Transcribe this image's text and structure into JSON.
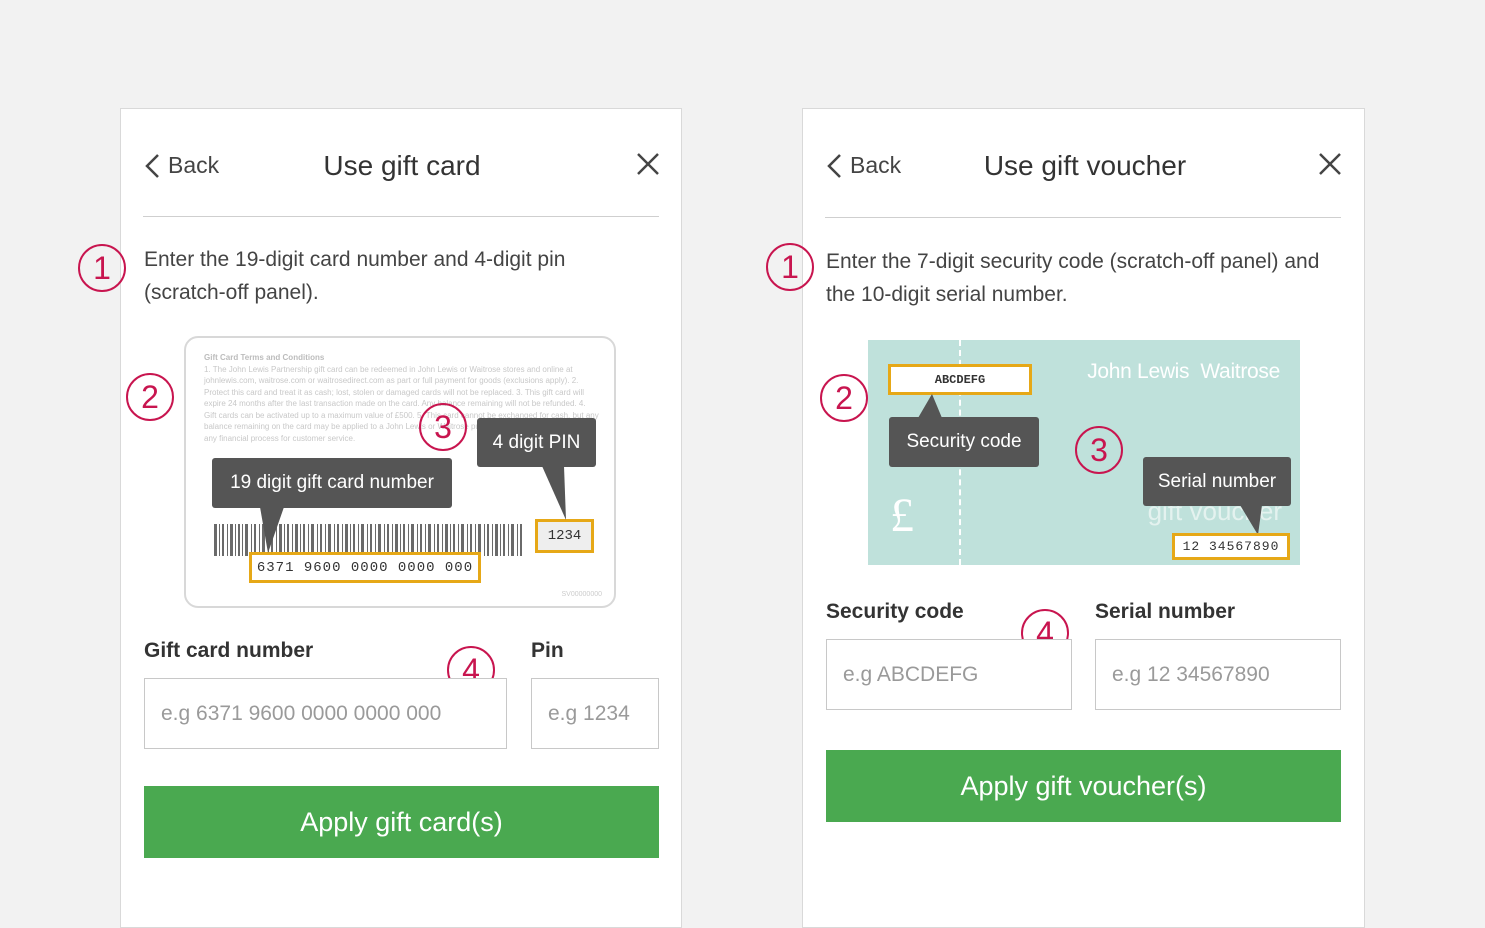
{
  "gift_card_panel": {
    "back_label": "Back",
    "title": "Use gift card",
    "instruction": "Enter the 19-digit card number and 4-digit pin (scratch-off panel).",
    "steps": [
      "1",
      "2",
      "3",
      "4"
    ],
    "card_image": {
      "terms_heading": "Gift Card Terms and Conditions",
      "terms_text": "1. The John Lewis Partnership gift card can be redeemed in John Lewis or Waitrose stores and online at johnlewis.com, waitrose.com or waitrosedirect.com as part or full payment for goods (exclusions apply). 2. Protect this card and treat it as cash; lost, stolen or damaged cards will not be replaced. 3. This gift card will expire 24 months after the last transaction made on the card. Any balance remaining will not be refunded. 4. Gift cards can be activated up to a maximum value of £500. 5. This card cannot be exchanged for cash, but any balance remaining on the card may be applied to a John Lewis or Waitrose purchase at any of our stores or by any financial process for customer service.",
      "card_number_tip": "19 digit gift card number",
      "pin_tip": "4 digit PIN",
      "sample_card_number": "6371 9600 0000 0000 000",
      "sample_pin": "1234",
      "card_id": "SV00000000"
    },
    "card_number_label": "Gift card number",
    "card_number_placeholder": "e.g 6371 9600 0000 0000 000",
    "pin_label": "Pin",
    "pin_placeholder": "e.g 1234",
    "apply_button": "Apply gift card(s)"
  },
  "voucher_panel": {
    "back_label": "Back",
    "title": "Use gift voucher",
    "instruction": "Enter the 7-digit security code (scratch-off panel) and the 10-digit serial number.",
    "steps": [
      "1",
      "2",
      "3",
      "4"
    ],
    "voucher_image": {
      "brand": "John Lewis  Waitrose",
      "sample_security_code": "ABCDEFG",
      "security_code_tip": "Security code",
      "serial_number_tip": "Serial number",
      "sample_serial": "12 34567890",
      "currency_symbol": "£",
      "watermark_text": "gift voucher"
    },
    "security_code_label": "Security code",
    "security_code_placeholder": "e.g ABCDEFG",
    "serial_number_label": "Serial number",
    "serial_number_placeholder": "e.g 12 34567890",
    "apply_button": "Apply gift voucher(s)"
  },
  "colors": {
    "accent_number": "#c8154f",
    "apply_button": "#4aa950",
    "highlight_box": "#e6a817",
    "voucher_bg": "#bfe1db",
    "tooltip": "#555555"
  }
}
